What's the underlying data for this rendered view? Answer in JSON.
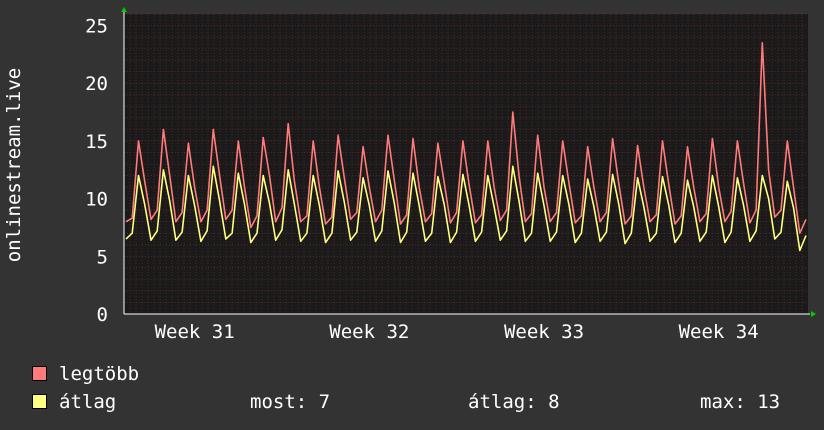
{
  "chart_data": {
    "type": "line",
    "ylabel": "onlinestream.live",
    "ylim": [
      0,
      26
    ],
    "y_ticks": [
      0,
      5,
      10,
      15,
      20,
      25
    ],
    "x_ticks": [
      "Week 31",
      "Week 32",
      "Week 33",
      "Week 34"
    ],
    "grid": true,
    "points_per_week": 28,
    "series": [
      {
        "name": "legtöbb",
        "color": "#ff7a7a",
        "values": [
          8.0,
          8.3,
          15.0,
          11.5,
          8.2,
          9.0,
          16.0,
          12.0,
          8.0,
          8.8,
          14.8,
          11.0,
          8.0,
          9.0,
          16.0,
          12.0,
          8.2,
          9.0,
          15.0,
          11.0,
          7.5,
          8.5,
          15.3,
          12.0,
          8.0,
          9.2,
          16.5,
          11.5,
          8.0,
          8.5,
          15.0,
          11.0,
          7.8,
          8.4,
          15.5,
          11.8,
          8.2,
          8.8,
          14.5,
          11.0,
          8.0,
          9.0,
          15.5,
          11.6,
          7.8,
          8.6,
          15.2,
          11.0,
          8.0,
          8.7,
          14.8,
          11.4,
          7.9,
          8.8,
          15.0,
          11.2,
          7.9,
          8.6,
          15.0,
          11.0,
          8.1,
          9.0,
          17.5,
          12.0,
          8.0,
          8.7,
          15.5,
          11.0,
          8.0,
          8.8,
          15.0,
          11.4,
          7.9,
          8.5,
          14.5,
          11.0,
          8.0,
          8.8,
          15.2,
          11.3,
          7.8,
          8.5,
          14.6,
          11.0,
          8.0,
          8.6,
          15.0,
          11.2,
          7.8,
          8.5,
          14.5,
          11.0,
          8.0,
          8.7,
          15.2,
          11.0,
          8.0,
          8.9,
          15.0,
          11.3,
          7.9,
          9.0,
          23.5,
          12.5,
          8.4,
          9.0,
          15.0,
          11.0,
          7.0,
          8.2
        ]
      },
      {
        "name": "átlag",
        "color": "#ffff80",
        "values": [
          6.5,
          7.0,
          12.0,
          9.5,
          6.4,
          7.2,
          12.5,
          9.8,
          6.4,
          7.1,
          12.0,
          9.4,
          6.3,
          7.2,
          12.8,
          9.8,
          6.5,
          7.0,
          12.2,
          9.5,
          6.2,
          7.0,
          12.0,
          9.6,
          6.4,
          7.3,
          12.5,
          9.5,
          6.3,
          7.0,
          12.0,
          9.4,
          6.2,
          7.0,
          12.4,
          9.7,
          6.4,
          7.1,
          11.8,
          9.4,
          6.3,
          7.2,
          12.4,
          9.6,
          6.2,
          7.1,
          12.2,
          9.4,
          6.3,
          7.0,
          11.9,
          9.5,
          6.2,
          7.1,
          12.1,
          9.4,
          6.3,
          7.1,
          12.0,
          9.3,
          6.4,
          7.2,
          12.8,
          9.8,
          6.3,
          7.0,
          12.2,
          9.4,
          6.3,
          7.1,
          12.0,
          9.5,
          6.2,
          7.0,
          11.7,
          9.3,
          6.3,
          7.1,
          12.1,
          9.5,
          6.1,
          7.0,
          11.8,
          9.3,
          6.3,
          7.0,
          11.9,
          9.4,
          6.2,
          7.0,
          11.6,
          9.3,
          6.3,
          7.1,
          12.0,
          9.3,
          6.2,
          7.1,
          11.8,
          9.4,
          6.3,
          7.2,
          12.0,
          10.0,
          6.5,
          7.1,
          11.5,
          9.2,
          5.5,
          6.8
        ]
      }
    ]
  },
  "legend": {
    "max_label": "legtöbb",
    "avg_label": "átlag"
  },
  "stats": {
    "now": "most: 7",
    "average": "átlag: 8",
    "max": "max: 13"
  },
  "colors": {
    "background": "#333333",
    "plot_background": "#1a1a1a",
    "grid": "#c04040",
    "arrow": "#00cc00"
  }
}
